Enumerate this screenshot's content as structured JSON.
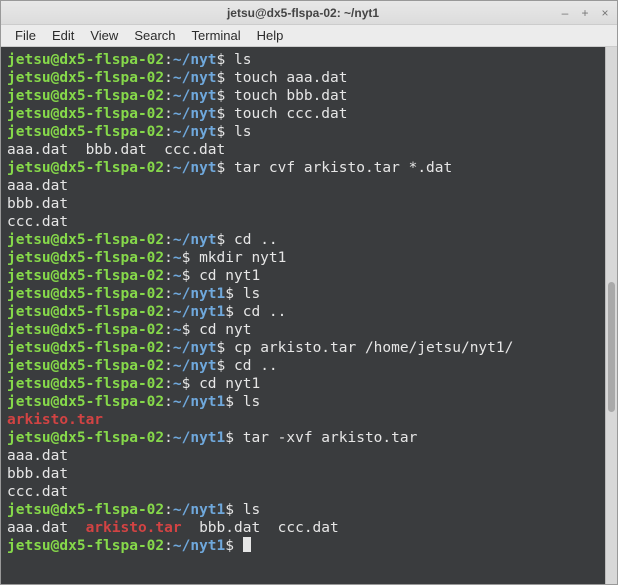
{
  "window": {
    "title": "jetsu@dx5-flspa-02: ~/nyt1",
    "controls": {
      "minimize": "–",
      "maximize": "+",
      "close": "×"
    }
  },
  "menubar": [
    "File",
    "Edit",
    "View",
    "Search",
    "Terminal",
    "Help"
  ],
  "colors": {
    "prompt_user": "#86d94a",
    "prompt_path": "#6fa8dc",
    "text": "#e6e6e6",
    "highlight_red": "#d24343",
    "terminal_bg": "#3a3c3e"
  },
  "prompt": {
    "user_host": "jetsu@dx5-flspa-02",
    "sep": ":",
    "dollar": "$"
  },
  "lines": [
    {
      "t": "prompt",
      "path": "~/nyt",
      "cmd": "ls"
    },
    {
      "t": "prompt",
      "path": "~/nyt",
      "cmd": "touch aaa.dat"
    },
    {
      "t": "prompt",
      "path": "~/nyt",
      "cmd": "touch bbb.dat"
    },
    {
      "t": "prompt",
      "path": "~/nyt",
      "cmd": "touch ccc.dat"
    },
    {
      "t": "prompt",
      "path": "~/nyt",
      "cmd": "ls"
    },
    {
      "t": "out",
      "text": "aaa.dat  bbb.dat  ccc.dat"
    },
    {
      "t": "prompt",
      "path": "~/nyt",
      "cmd": "tar cvf arkisto.tar *.dat"
    },
    {
      "t": "out",
      "text": "aaa.dat"
    },
    {
      "t": "out",
      "text": "bbb.dat"
    },
    {
      "t": "out",
      "text": "ccc.dat"
    },
    {
      "t": "prompt",
      "path": "~/nyt",
      "cmd": "cd .."
    },
    {
      "t": "prompt",
      "path": "~",
      "cmd": "mkdir nyt1"
    },
    {
      "t": "prompt",
      "path": "~",
      "cmd": "cd nyt1"
    },
    {
      "t": "prompt",
      "path": "~/nyt1",
      "cmd": "ls"
    },
    {
      "t": "prompt",
      "path": "~/nyt1",
      "cmd": "cd .."
    },
    {
      "t": "prompt",
      "path": "~",
      "cmd": "cd nyt"
    },
    {
      "t": "prompt",
      "path": "~/nyt",
      "cmd": "cp arkisto.tar /home/jetsu/nyt1/"
    },
    {
      "t": "prompt",
      "path": "~/nyt",
      "cmd": "cd .."
    },
    {
      "t": "prompt",
      "path": "~",
      "cmd": "cd nyt1"
    },
    {
      "t": "prompt",
      "path": "~/nyt1",
      "cmd": "ls"
    },
    {
      "t": "red",
      "text": "arkisto.tar"
    },
    {
      "t": "prompt",
      "path": "~/nyt1",
      "cmd": "tar -xvf arkisto.tar"
    },
    {
      "t": "out",
      "text": "aaa.dat"
    },
    {
      "t": "out",
      "text": "bbb.dat"
    },
    {
      "t": "out",
      "text": "ccc.dat"
    },
    {
      "t": "prompt",
      "path": "~/nyt1",
      "cmd": "ls"
    },
    {
      "t": "mixed",
      "segments": [
        {
          "c": "w",
          "text": "aaa.dat  "
        },
        {
          "c": "r",
          "text": "arkisto.tar"
        },
        {
          "c": "w",
          "text": "  bbb.dat  ccc.dat"
        }
      ]
    },
    {
      "t": "prompt",
      "path": "~/nyt1",
      "cmd": "",
      "cursor": true
    }
  ]
}
